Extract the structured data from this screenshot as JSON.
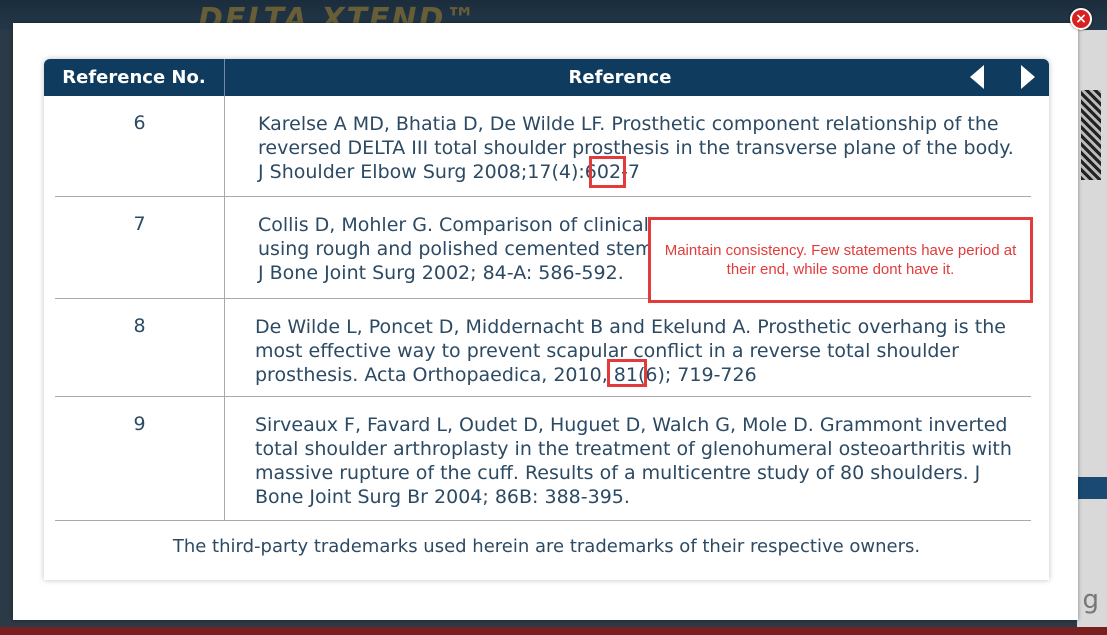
{
  "background": {
    "brand": "DELTA XTEND™",
    "right_fragment": "g"
  },
  "modal": {
    "close_icon": "×",
    "table": {
      "headers": {
        "reference_no": "Reference No.",
        "reference": "Reference"
      },
      "nav": {
        "prev_icon": "triangle-left",
        "next_icon": "triangle-right"
      },
      "rows": [
        {
          "no": "6",
          "text": "Karelse A MD, Bhatia D, De Wilde LF. Prosthetic component relationship of the reversed DELTA III total shoulder prosthesis in the transverse plane of the body. J Shoulder Elbow Surg 2008;17(4):602-7"
        },
        {
          "no": "7",
          "text": "Collis D, Mohler G. Comparison of clinical outcomes in total hip arthroplasty using rough and polished cemented stems with essentially the same geometry. J Bone Joint Surg 2002; 84-A: 586-592."
        },
        {
          "no": "8",
          "text": "De Wilde L, Poncet D, Middernacht B and Ekelund A. Prosthetic overhang is the most effective way to prevent scapular conflict in a reverse total shoulder prosthesis. Acta Orthopaedica, 2010, 81(6); 719-726"
        },
        {
          "no": "9",
          "text": "Sirveaux F, Favard L, Oudet D, Huguet D, Walch G, Mole D. Grammont inverted total shoulder arthroplasty in the treatment of glenohumeral osteoarthritis with massive rupture of the cuff. Results of a multicentre study of 80 shoulders. J Bone Joint Surg Br 2004; 86B: 388-395."
        }
      ],
      "footer": "The third-party trademarks used herein are trademarks of their respective owners."
    }
  },
  "annotation": {
    "comment": "Maintain consistency. Few statements have period at their end, while some dont have it.",
    "color": "#e23b3b"
  }
}
